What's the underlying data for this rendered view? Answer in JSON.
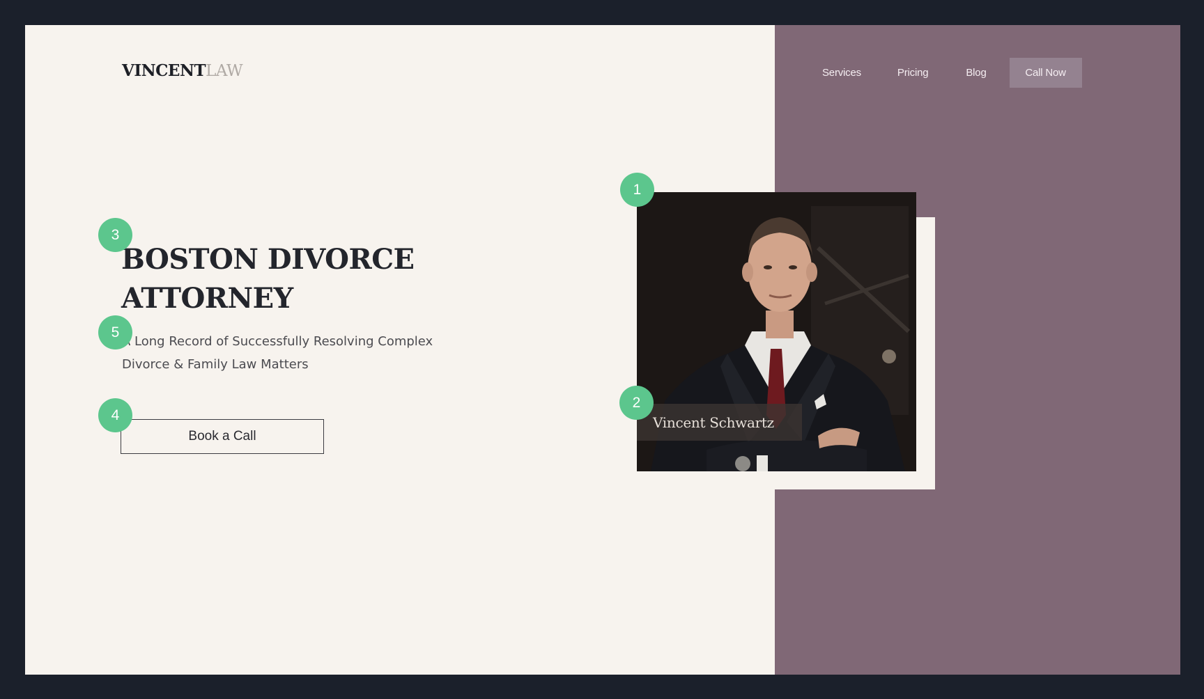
{
  "brand": {
    "name_bold": "VINCENT",
    "name_light": "LAW"
  },
  "nav": {
    "links": [
      "Services",
      "Pricing",
      "Blog"
    ],
    "cta": "Call Now"
  },
  "hero": {
    "headline_line1": "BOSTON DIVORCE",
    "headline_line2": "ATTORNEY",
    "subtitle": "A Long Record of Successfully Resolving Complex Divorce & Family Law Matters",
    "button": "Book a Call"
  },
  "portrait": {
    "name": "Vincent Schwartz"
  },
  "markers": [
    "1",
    "2",
    "3",
    "4",
    "5"
  ],
  "colors": {
    "page_bg": "#1b202b",
    "content_bg": "#f7f3ee",
    "panel": "#806876",
    "marker": "#5cc68d"
  }
}
